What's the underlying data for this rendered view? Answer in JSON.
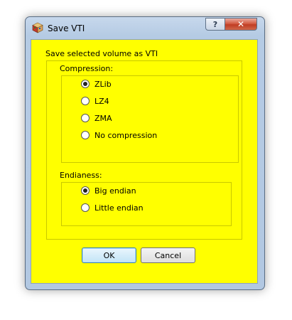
{
  "window": {
    "title": "Save VTI",
    "help_glyph": "?",
    "close_glyph": "✕",
    "icon": "3d-cube-icon"
  },
  "dialog": {
    "heading": "Save  selected volume as VTI",
    "compression": {
      "label": "Compression:",
      "options": [
        {
          "label": "ZLib",
          "checked": true
        },
        {
          "label": "LZ4",
          "checked": false
        },
        {
          "label": "ZMA",
          "checked": false
        },
        {
          "label": "No compression",
          "checked": false
        }
      ]
    },
    "endianess": {
      "label": "Endianess:",
      "options": [
        {
          "label": "Big endian",
          "checked": true
        },
        {
          "label": "Little endian",
          "checked": false
        }
      ]
    },
    "buttons": {
      "ok": "OK",
      "cancel": "Cancel"
    }
  },
  "colors": {
    "client_background": "#ffff00",
    "titlebar": "#b5cbe4",
    "close_button": "#c8452c"
  }
}
